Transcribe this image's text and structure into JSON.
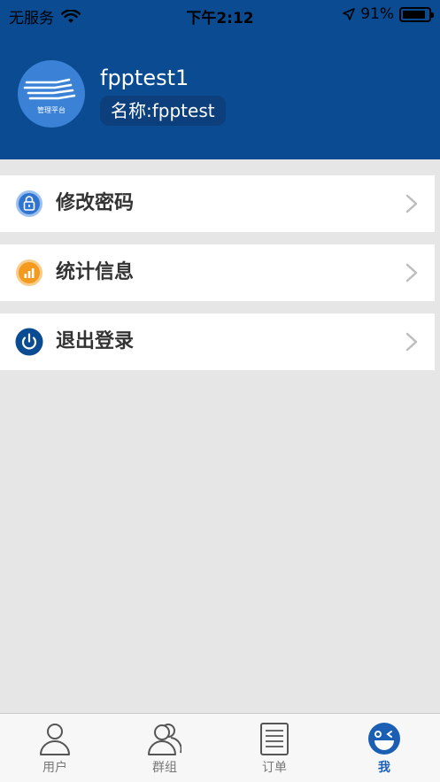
{
  "status_bar": {
    "carrier": "无服务",
    "time": "下午2:12",
    "battery_percent": "91%",
    "battery_level": 0.91
  },
  "profile": {
    "avatar_text": "管理平台",
    "username": "fpptest1",
    "name_label": "名称:fpptest"
  },
  "menu": {
    "items": [
      {
        "label": "修改密码",
        "icon": "lock-icon",
        "color": "#2f74d0"
      },
      {
        "label": "统计信息",
        "icon": "bar-chart-icon",
        "color": "#f39a1f"
      },
      {
        "label": "退出登录",
        "icon": "power-icon",
        "color": "#0a4b92"
      }
    ]
  },
  "tabbar": {
    "tabs": [
      {
        "label": "用户",
        "icon": "user-icon"
      },
      {
        "label": "群组",
        "icon": "group-icon"
      },
      {
        "label": "订单",
        "icon": "order-icon"
      },
      {
        "label": "我",
        "icon": "me-face-icon"
      }
    ],
    "active_index": 3
  },
  "colors": {
    "header": "#0a4b92",
    "active_tab": "#1a5fb4",
    "background": "#e6e6e6"
  }
}
